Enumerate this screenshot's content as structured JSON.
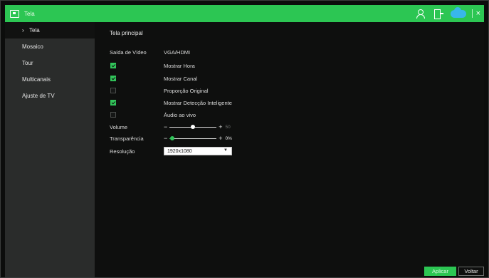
{
  "window": {
    "title": "Tela",
    "brand_color": "#2cc653",
    "icons": [
      "monitor-icon",
      "user-icon",
      "exit-icon",
      "cloud-icon",
      "close-icon"
    ],
    "close_glyph": "×"
  },
  "sidebar": {
    "items": [
      {
        "label": "Tela",
        "active": true,
        "chevron": "›"
      },
      {
        "label": "Mosaico",
        "active": false
      },
      {
        "label": "Tour",
        "active": false
      },
      {
        "label": "Multicanais",
        "active": false
      },
      {
        "label": "Ajuste de TV",
        "active": false
      }
    ]
  },
  "main": {
    "section_title": "Tela principal",
    "video_output": {
      "label": "Saída de Vídeo",
      "value": "VGA/HDMI"
    },
    "options": [
      {
        "label": "Mostrar Hora",
        "checked": true,
        "enabled": true
      },
      {
        "label": "Mostrar Canal",
        "checked": true,
        "enabled": true
      },
      {
        "label": "Proporção Original",
        "checked": false,
        "enabled": true
      },
      {
        "label": "Mostrar Detecção Inteligente",
        "checked": true,
        "enabled": true
      },
      {
        "label": "Áudio ao vivo",
        "checked": false,
        "enabled": false
      }
    ],
    "volume": {
      "label": "Volume",
      "value": "50",
      "fraction": 0.5,
      "minus": "−",
      "plus": "+"
    },
    "transparency": {
      "label": "Transparência",
      "value": "0%",
      "fraction": 0.0,
      "minus": "−",
      "plus": "+"
    },
    "resolution": {
      "label": "Resolução",
      "value": "1920x1080",
      "caret": "▼"
    }
  },
  "footer": {
    "apply_label": "Aplicar",
    "back_label": "Voltar"
  }
}
